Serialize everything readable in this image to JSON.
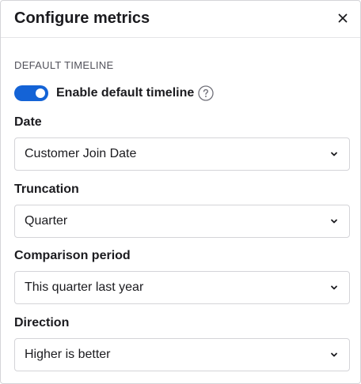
{
  "dialog": {
    "title": "Configure metrics",
    "close_icon": "close-icon"
  },
  "section": {
    "label": "DEFAULT TIMELINE"
  },
  "toggle": {
    "label": "Enable default timeline",
    "enabled": true,
    "accent_color": "#1463d6",
    "help_icon": "help-icon"
  },
  "fields": [
    {
      "label": "Date",
      "value": "Customer Join Date"
    },
    {
      "label": "Truncation",
      "value": "Quarter"
    },
    {
      "label": "Comparison period",
      "value": "This quarter last year"
    },
    {
      "label": "Direction",
      "value": "Higher is better"
    }
  ]
}
